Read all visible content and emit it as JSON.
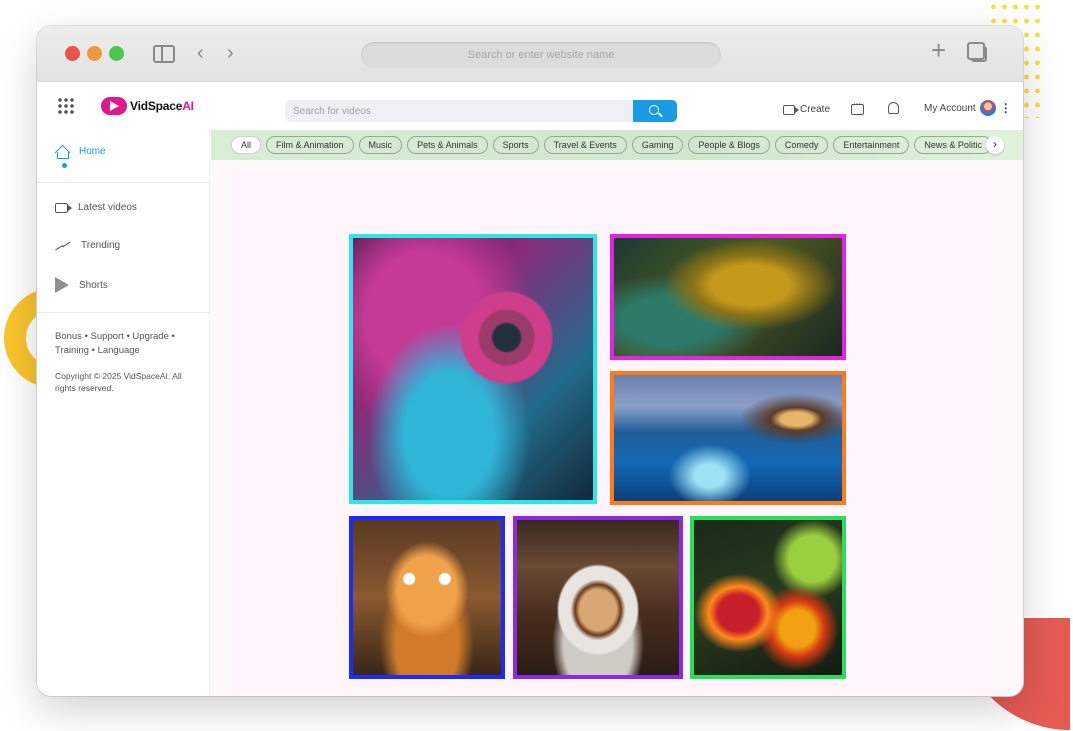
{
  "browser": {
    "address_placeholder": "Search or enter website name"
  },
  "header": {
    "logo_main": "VidSpace",
    "logo_suffix": "AI",
    "search_placeholder": "Search for videos",
    "create_label": "Create",
    "account_label": "My Account"
  },
  "sidebar": {
    "items": [
      {
        "label": "Home",
        "icon": "home-icon",
        "active": true
      },
      {
        "label": "Latest videos",
        "icon": "video-camera-icon"
      },
      {
        "label": "Trending",
        "icon": "trending-icon"
      },
      {
        "label": "Shorts",
        "icon": "shorts-play-icon"
      }
    ],
    "links_line1": "Bonus • Support • Upgrade •",
    "links_line2": "Training • Language",
    "copyright": "Copyright © 2025 VidSpaceAI. All rights reserved."
  },
  "categories": [
    "All",
    "Film & Animation",
    "Music",
    "Pets & Animals",
    "Sports",
    "Travel & Events",
    "Gaming",
    "People & Blogs",
    "Comedy",
    "Entertainment",
    "News & Politic"
  ],
  "gallery": {
    "tiles": [
      {
        "subject": "chameleon",
        "border": "#2ee6e6"
      },
      {
        "subject": "leaf",
        "border": "#e024e0"
      },
      {
        "subject": "overwater-walkway",
        "border": "#ff7a1a"
      },
      {
        "subject": "kitten",
        "border": "#1b2bff"
      },
      {
        "subject": "coffee-cup",
        "border": "#8a2be2"
      },
      {
        "subject": "autumn-leaves",
        "border": "#27e05a"
      }
    ]
  },
  "colors": {
    "accent": "#1a9be5",
    "brand": "#e0178a",
    "category_bar": "#d9ecd6"
  }
}
